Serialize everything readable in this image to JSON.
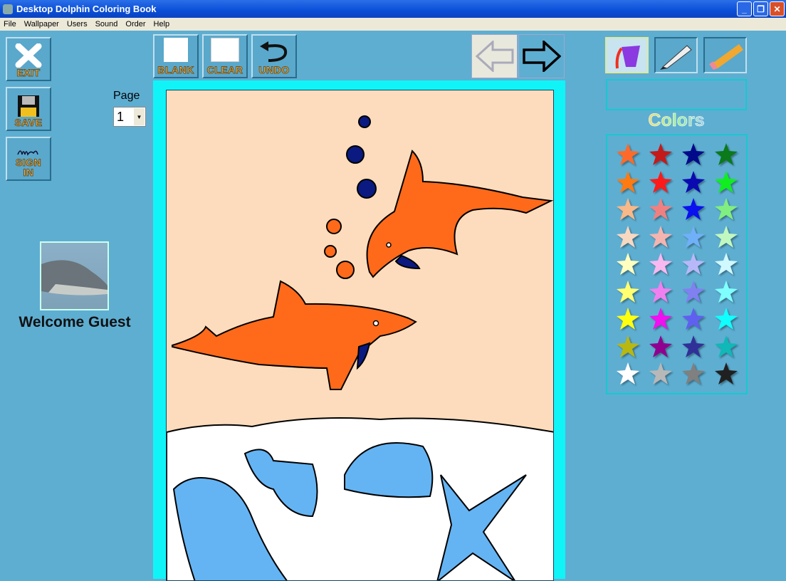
{
  "window": {
    "title": "Desktop Dolphin Coloring Book"
  },
  "menu": [
    "File",
    "Wallpaper",
    "Users",
    "Sound",
    "Order",
    "Help"
  ],
  "left_buttons": {
    "exit": "EXIT",
    "save": "SAVE",
    "sign_in": "SIGN IN"
  },
  "toolbar": {
    "blank": "BLANK",
    "clear": "CLEAR",
    "undo": "UNDO"
  },
  "page": {
    "label": "Page",
    "value": "1"
  },
  "user": {
    "welcome": "Welcome Guest"
  },
  "tools": [
    {
      "name": "paint-bucket",
      "selected": true
    },
    {
      "name": "marker",
      "selected": false
    },
    {
      "name": "pencil-eraser",
      "selected": false
    }
  ],
  "colors_title": "Colors",
  "palette": [
    "#ff6a2a",
    "#c41a1a",
    "#000a8a",
    "#0a7a1a",
    "#ff7a10",
    "#ff1a1a",
    "#0a0ab0",
    "#10ee20",
    "#f8b888",
    "#f08080",
    "#0a10ee",
    "#80ee80",
    "#f8d8c0",
    "#f4b4b0",
    "#70b0f8",
    "#c0f8c0",
    "#ffffc0",
    "#f8b8f0",
    "#b8b8f8",
    "#d0f8ff",
    "#ffff70",
    "#f080f0",
    "#8080f0",
    "#80ffff",
    "#ffff10",
    "#f010f0",
    "#6060f0",
    "#10ffff",
    "#b8b810",
    "#900090",
    "#303098",
    "#10b8b8",
    "#ffffff",
    "#b8b8b8",
    "#808080",
    "#202020"
  ]
}
